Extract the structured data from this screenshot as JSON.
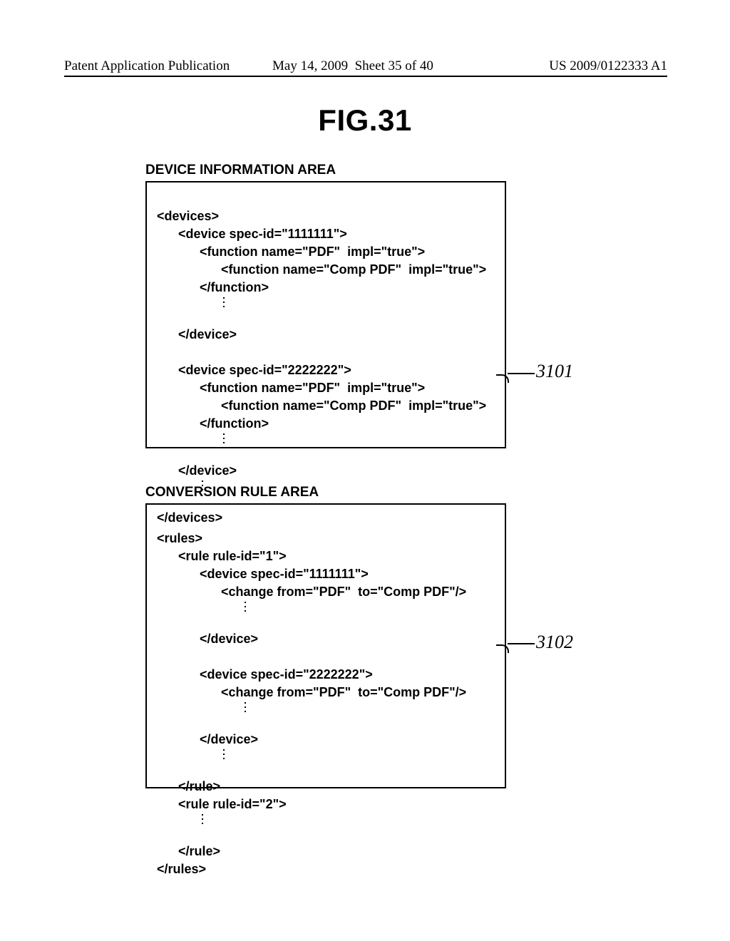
{
  "header": {
    "left": "Patent Application Publication",
    "mid_date": "May 14, 2009",
    "mid_sheet": "Sheet 35 of 40",
    "right": "US 2009/0122333 A1"
  },
  "figure_title": "FIG.31",
  "device_area": {
    "label": "DEVICE INFORMATION AREA",
    "lines": {
      "l01": "<devices>",
      "l02": "<device spec-id=\"1111111\">",
      "l03": "<function name=\"PDF\"  impl=\"true\">",
      "l04": "<function name=\"Comp PDF\"  impl=\"true\">",
      "l05": "</function>",
      "l06": "</device>",
      "l07": "<device spec-id=\"2222222\">",
      "l08": "<function name=\"PDF\"  impl=\"true\">",
      "l09": "<function name=\"Comp PDF\"  impl=\"true\">",
      "l10": "</function>",
      "l11": "</device>",
      "l12": "</devices>"
    },
    "ref": "3101"
  },
  "rule_area": {
    "label": "CONVERSION RULE AREA",
    "lines": {
      "r01": "<rules>",
      "r02": "<rule rule-id=\"1\">",
      "r03": "<device spec-id=\"1111111\">",
      "r04": "<change from=\"PDF\"  to=\"Comp PDF\"/>",
      "r05": "</device>",
      "r06": "<device spec-id=\"2222222\">",
      "r07": "<change from=\"PDF\"  to=\"Comp PDF\"/>",
      "r08": "</device>",
      "r09": "</rule>",
      "r10": "<rule rule-id=\"2\">",
      "r11": "</rule>",
      "r12": "</rules>"
    },
    "ref": "3102"
  }
}
